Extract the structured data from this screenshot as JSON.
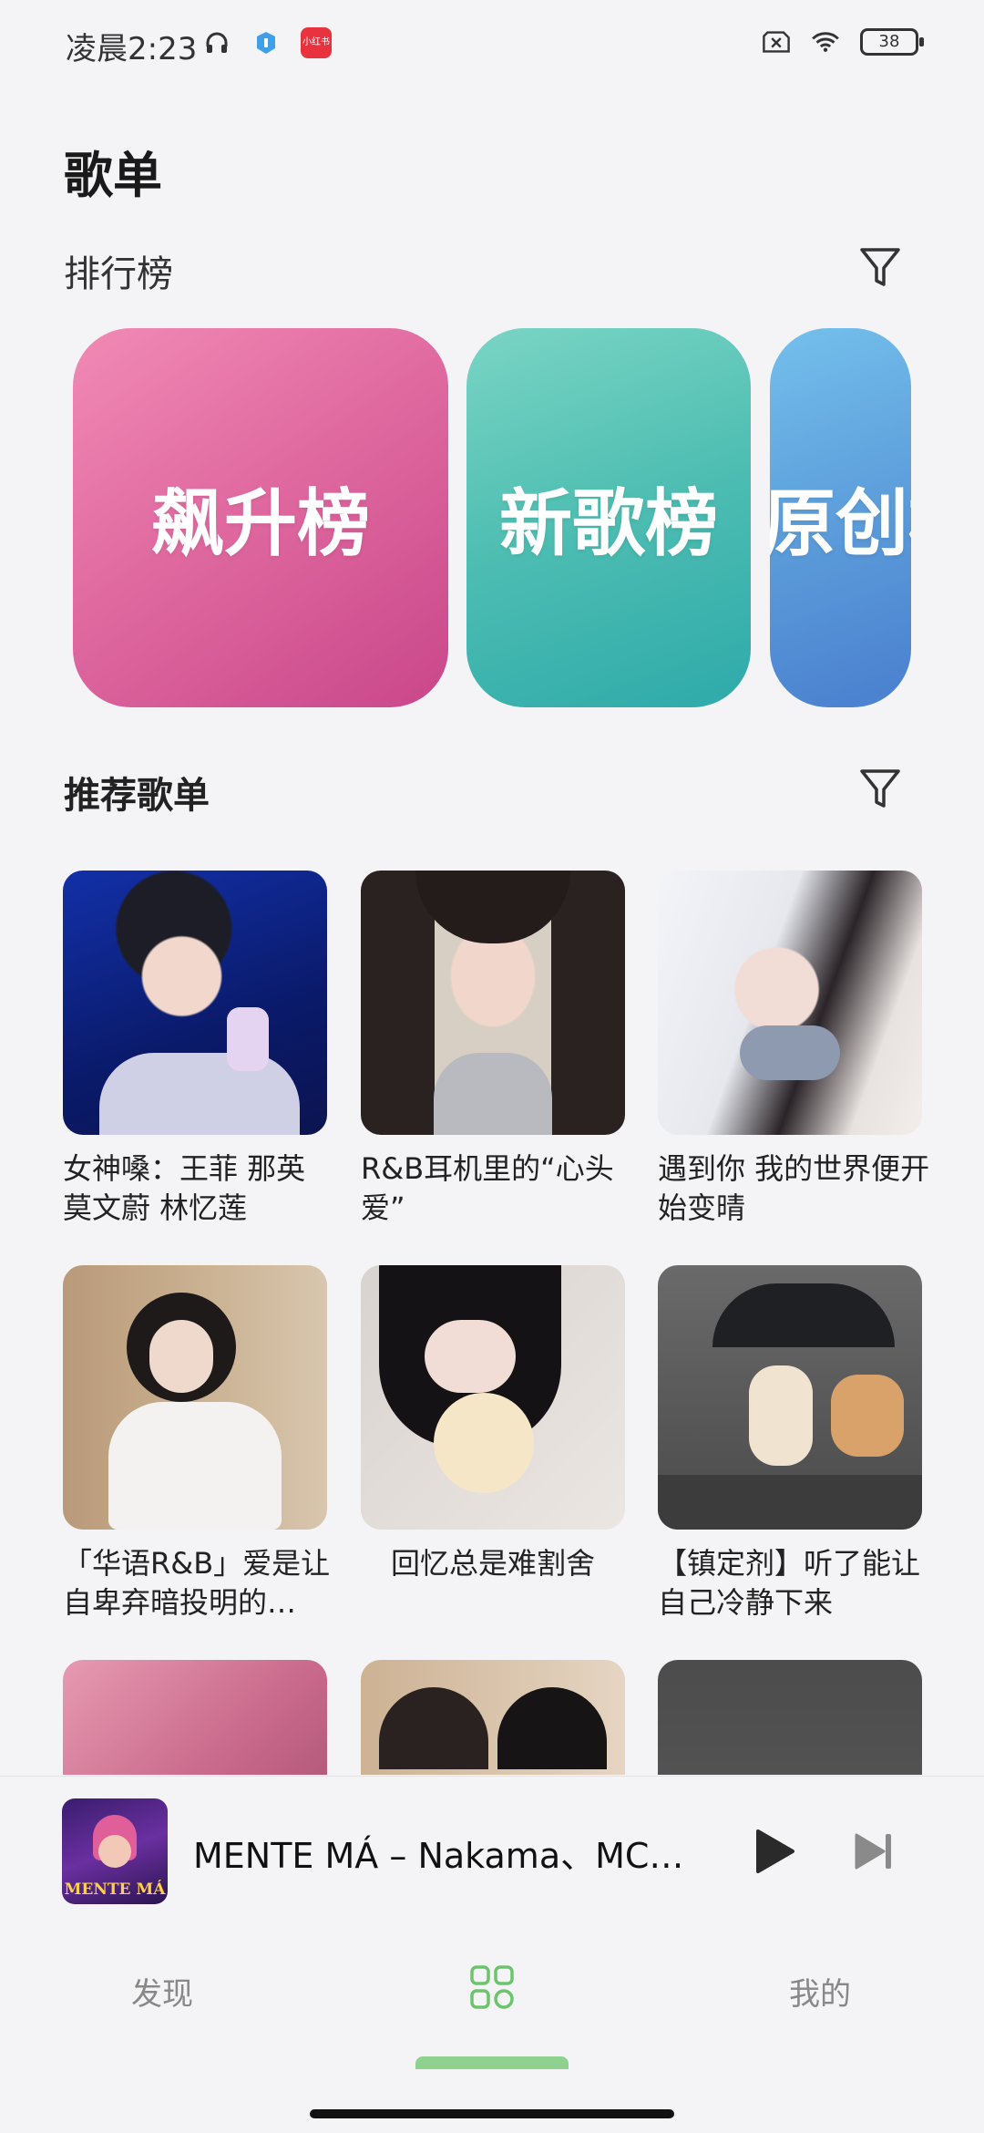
{
  "status_bar": {
    "time": "凌晨2:23",
    "app_badge": "小红书",
    "battery": "38"
  },
  "page": {
    "title": "歌单"
  },
  "sections": {
    "ranking_title": "排行榜",
    "recommended_title": "推荐歌单"
  },
  "charts": [
    {
      "label": "飙升榜",
      "color": "#e06aa0"
    },
    {
      "label": "新歌榜",
      "color": "#4dbdb2"
    },
    {
      "label": "原创榜",
      "color": "#5a9ad9"
    }
  ],
  "playlists": [
    {
      "title": "女神嗓：王菲 那英 莫文蔚 林忆莲"
    },
    {
      "title": "R&B耳机里的“心头爱”"
    },
    {
      "title": "遇到你 我的世界便开始变晴"
    },
    {
      "title": "「华语R&B」爱是让自卑弃暗投明的…"
    },
    {
      "title": "回忆总是难割舍"
    },
    {
      "title": "【镇定剂】听了能让自己冷静下来"
    },
    {
      "title": ""
    },
    {
      "title": ""
    },
    {
      "title": ""
    }
  ],
  "mini_player": {
    "song": "MENTE MÁ – Nakama、MC …",
    "cover_text": "MENTE MÁ"
  },
  "nav": {
    "discover": "发现",
    "mine": "我的"
  },
  "colors": {
    "accent": "#6cc46c",
    "background": "#f4f4f6"
  }
}
